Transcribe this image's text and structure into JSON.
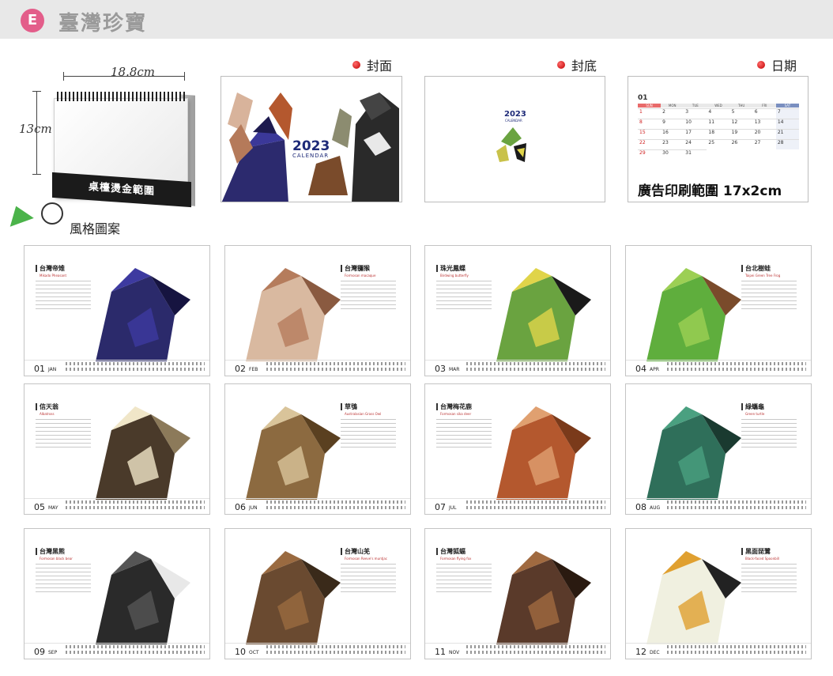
{
  "header": {
    "badge": "E",
    "title": "臺灣珍寶"
  },
  "mockup": {
    "width_label": "18.8cm",
    "height_label": "13cm",
    "base_text": "桌檯燙金範圍"
  },
  "sections": {
    "cover": "封面",
    "back": "封底",
    "dates": "日期"
  },
  "cover": {
    "year": "2023",
    "sub": "CALENDAR"
  },
  "back": {
    "year": "2023",
    "sub": "CALENDAR"
  },
  "dates": {
    "month": "01",
    "weekdays": [
      "SUN",
      "MON",
      "TUE",
      "WED",
      "THU",
      "FRI",
      "SAT"
    ],
    "days": [
      "1",
      "2",
      "3",
      "4",
      "5",
      "6",
      "7",
      "8",
      "9",
      "10",
      "11",
      "12",
      "13",
      "14",
      "15",
      "16",
      "17",
      "18",
      "19",
      "20",
      "21",
      "22",
      "23",
      "24",
      "25",
      "26",
      "27",
      "28",
      "29",
      "30",
      "31"
    ],
    "caption": "廣告印刷範圍 17x2cm"
  },
  "style_label": "風格圖案",
  "months": [
    {
      "num": "01",
      "abbr": "JAN",
      "name_zh": "台灣帝雉",
      "name_en": "Mikado Pheasant"
    },
    {
      "num": "02",
      "abbr": "FEB",
      "name_zh": "台灣獼猴",
      "name_en": "Formosan macaque"
    },
    {
      "num": "03",
      "abbr": "MAR",
      "name_zh": "珠光鳳蝶",
      "name_en": "Birdwing butterfly"
    },
    {
      "num": "04",
      "abbr": "APR",
      "name_zh": "台北樹蛙",
      "name_en": "Taipei Green Tree Frog"
    },
    {
      "num": "05",
      "abbr": "MAY",
      "name_zh": "信天翁",
      "name_en": "Albatross"
    },
    {
      "num": "06",
      "abbr": "JUN",
      "name_zh": "草鴞",
      "name_en": "Australasian Grass Owl"
    },
    {
      "num": "07",
      "abbr": "JUL",
      "name_zh": "台灣梅花鹿",
      "name_en": "Formosan sika deer"
    },
    {
      "num": "08",
      "abbr": "AUG",
      "name_zh": "綠蠵龜",
      "name_en": "Green turtle"
    },
    {
      "num": "09",
      "abbr": "SEP",
      "name_zh": "台灣黑熊",
      "name_en": "Formosan black bear"
    },
    {
      "num": "10",
      "abbr": "OCT",
      "name_zh": "台灣山羌",
      "name_en": "Formosan Reeve's muntjac"
    },
    {
      "num": "11",
      "abbr": "NOV",
      "name_zh": "台灣狐蝠",
      "name_en": "Formosan flying fox"
    },
    {
      "num": "12",
      "abbr": "DEC",
      "name_zh": "黑面琵鷺",
      "name_en": "Black-faced Spoonbill"
    }
  ],
  "colors": {
    "badge": "#e35d8a",
    "accent_red": "#c00000",
    "navy": "#1e2a78",
    "style_green": "#4bb34a"
  }
}
